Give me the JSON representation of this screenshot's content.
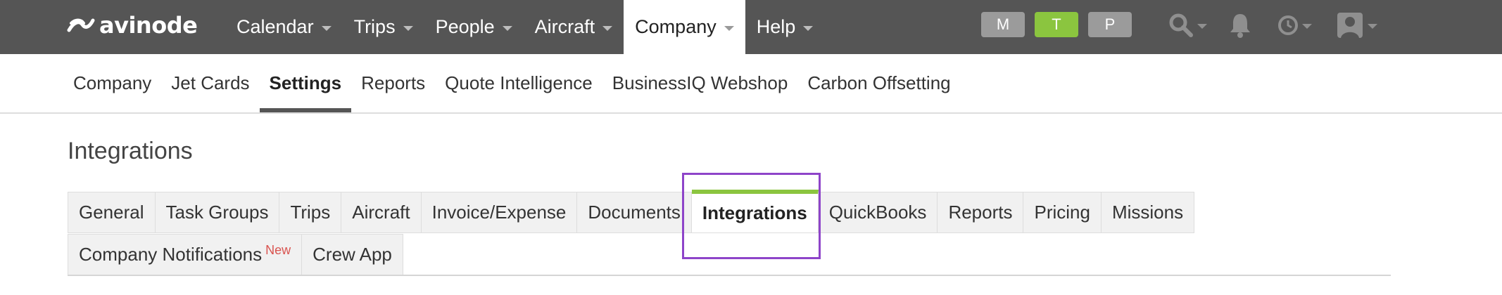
{
  "brand": {
    "name": "avinode"
  },
  "nav": {
    "items": [
      {
        "label": "Calendar",
        "active": false
      },
      {
        "label": "Trips",
        "active": false
      },
      {
        "label": "People",
        "active": false
      },
      {
        "label": "Aircraft",
        "active": false
      },
      {
        "label": "Company",
        "active": true
      },
      {
        "label": "Help",
        "active": false
      }
    ],
    "modes": [
      {
        "label": "M",
        "color": "#9b9b9b"
      },
      {
        "label": "T",
        "color": "#8bc53f"
      },
      {
        "label": "P",
        "color": "#9b9b9b"
      }
    ],
    "tools": [
      "search-icon",
      "bell-icon",
      "clock-icon",
      "user-avatar-icon"
    ]
  },
  "subnav": {
    "items": [
      {
        "label": "Company",
        "active": false
      },
      {
        "label": "Jet Cards",
        "active": false
      },
      {
        "label": "Settings",
        "active": true
      },
      {
        "label": "Reports",
        "active": false
      },
      {
        "label": "Quote Intelligence",
        "active": false
      },
      {
        "label": "BusinessIQ Webshop",
        "active": false
      },
      {
        "label": "Carbon Offsetting",
        "active": false
      }
    ]
  },
  "page": {
    "title": "Integrations"
  },
  "tabs": {
    "row1": [
      {
        "label": "General",
        "active": false
      },
      {
        "label": "Task Groups",
        "active": false
      },
      {
        "label": "Trips",
        "active": false
      },
      {
        "label": "Aircraft",
        "active": false
      },
      {
        "label": "Invoice/Expense",
        "active": false
      },
      {
        "label": "Documents",
        "active": false
      },
      {
        "label": "Integrations",
        "active": true
      },
      {
        "label": "QuickBooks",
        "active": false
      },
      {
        "label": "Reports",
        "active": false
      },
      {
        "label": "Pricing",
        "active": false
      },
      {
        "label": "Missions",
        "active": false
      }
    ],
    "row2": [
      {
        "label": "Company Notifications",
        "badge": "New",
        "active": false
      },
      {
        "label": "Crew App",
        "active": false
      }
    ]
  },
  "colors": {
    "topbar": "#555555",
    "accent_green": "#8bc53f",
    "highlight": "#8e44c9",
    "badge_red": "#d9534f"
  }
}
